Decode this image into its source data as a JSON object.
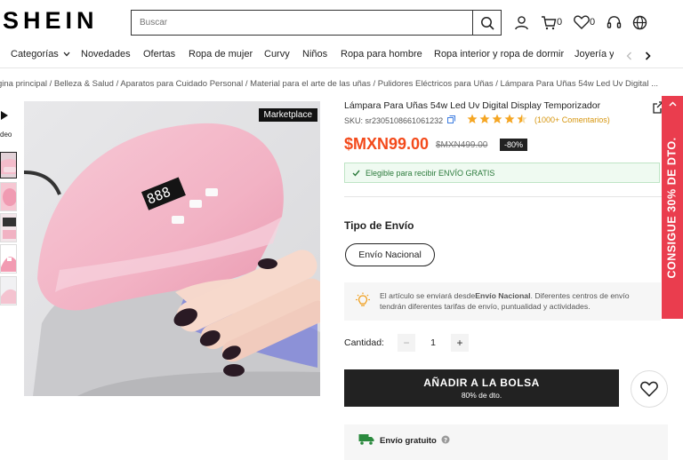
{
  "header": {
    "logo": "SHEIN",
    "search_placeholder": "Buscar",
    "cart_count": "0",
    "wishlist_count": "0"
  },
  "nav": {
    "items": [
      "Categorías",
      "Novedades",
      "Ofertas",
      "Ropa de mujer",
      "Curvy",
      "Niños",
      "Ropa para hombre",
      "Ropa interior y ropa de dormir",
      "Joyería y c"
    ]
  },
  "breadcrumb": "gina principal / Belleza & Salud / Aparatos para Cuidado Personal / Material para el arte de las uñas / Pulidores Eléctricos para Uñas / Lámpara Para Uñas 54w Led Uv Digital ...",
  "gallery": {
    "video_label": "deo",
    "badge": "Marketplace"
  },
  "product": {
    "title": "Lámpara Para Uñas 54w Led Uv Digital Display Temporizador",
    "sku": "SKU: sr2305108661061232",
    "rating": 4.5,
    "reviews": "(1000+ Comentarios)",
    "price": "$MXN99.00",
    "price_old": "$MXN499.00",
    "discount": "-80%",
    "free_shipping": "Elegible para recibir ENVÍO GRATIS",
    "shipping_type_label": "Tipo de Envío",
    "shipping_option": "Envío Nacional",
    "shipping_info_prefix": "El artículo se enviará desde",
    "shipping_info_bold": "Envío Nacional",
    "shipping_info_suffix": ". Diferentes centros de envío tendrán diferentes tarifas de envío, puntualidad y actividades.",
    "quantity_label": "Cantidad:",
    "quantity_value": "1",
    "add_button": "AÑADIR A LA BOLSA",
    "add_button_sub": "80% de dto.",
    "shipping_box_title": "Envío gratuito"
  },
  "promo": {
    "text": "CONSIGUE 30% DE DTO.",
    "color": "#ea3d4e"
  },
  "colors": {
    "price": "#f34a1b",
    "stars": "#f5a623",
    "primary_button": "#222222"
  }
}
